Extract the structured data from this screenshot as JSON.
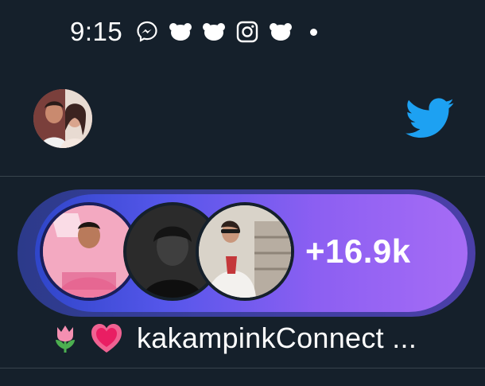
{
  "status_bar": {
    "time": "9:15",
    "icons": [
      "messenger-icon",
      "bear-icon",
      "bear-icon",
      "instagram-icon",
      "bear-icon",
      "notification-dot-icon"
    ]
  },
  "header": {
    "profile_avatar": "avatar",
    "logo": "twitter-bird-icon"
  },
  "fleet": {
    "extra_count": "+16.9k",
    "bubble_images": [
      "profile-bubble-pink-campaign",
      "profile-bubble-dark-portrait",
      "profile-bubble-woman-stairs"
    ]
  },
  "footer_label": {
    "emojis": [
      "tulip-icon",
      "heart-icon"
    ],
    "text": "kakampinkConnect ..."
  },
  "colors": {
    "background": "#15202b",
    "twitter_blue": "#1da1f2",
    "pill_start": "#2f46c9",
    "pill_end": "#a66cf5",
    "divider": "#38444d"
  }
}
